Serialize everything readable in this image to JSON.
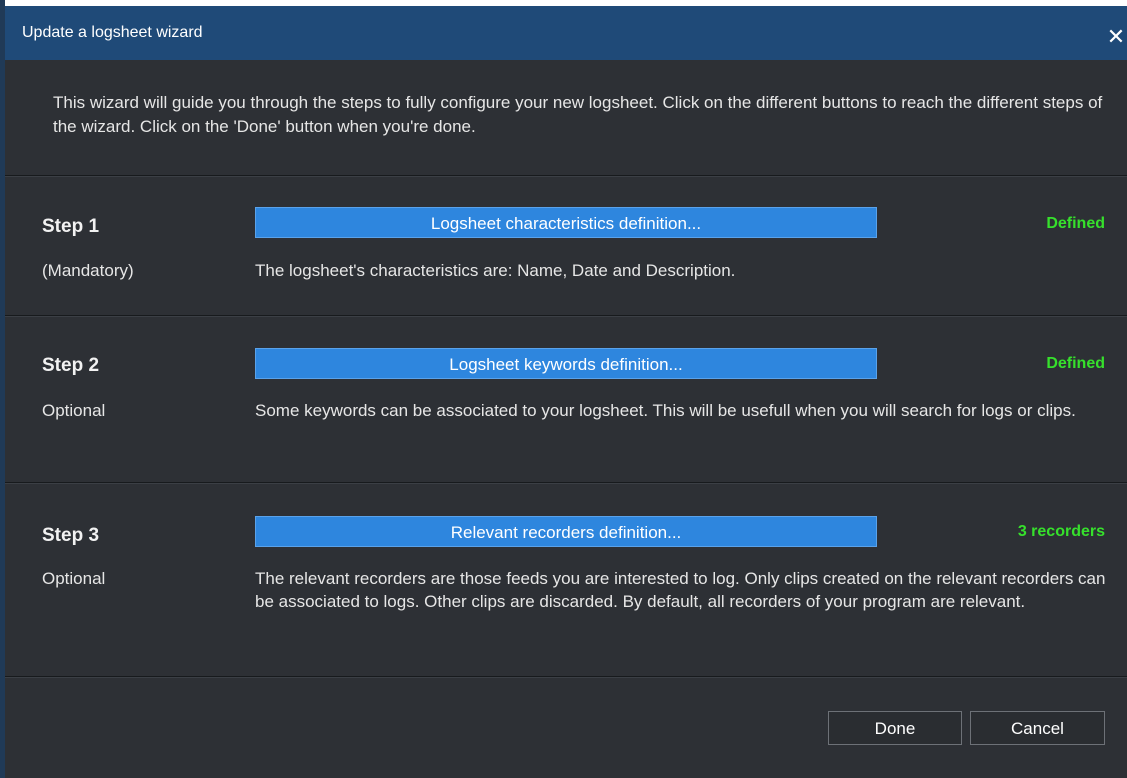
{
  "dialog": {
    "title": "Update a logsheet wizard",
    "close_icon": "✕",
    "intro": "This wizard will guide you through the steps to fully configure your new logsheet. Click on the different buttons to reach the different steps of the wizard. Click on the 'Done' button when you're done."
  },
  "steps": [
    {
      "label": "Step 1",
      "sub": "(Mandatory)",
      "button": "Logsheet characteristics definition...",
      "status": "Defined",
      "description": "The logsheet's characteristics are: Name, Date and Description."
    },
    {
      "label": "Step 2",
      "sub": "Optional",
      "button": "Logsheet keywords definition...",
      "status": "Defined",
      "description": "Some keywords can be associated to your logsheet. This will be usefull when you will search for logs or clips."
    },
    {
      "label": "Step 3",
      "sub": "Optional",
      "button": "Relevant recorders definition...",
      "status": "3 recorders",
      "description": "The relevant recorders are those feeds you are interested to log. Only clips created on the relevant recorders can be associated to logs. Other clips are discarded. By default, all recorders of your program are relevant."
    }
  ],
  "footer": {
    "done_label": "Done",
    "cancel_label": "Cancel"
  },
  "colors": {
    "titlebar": "#1f4a78",
    "background": "#2d3035",
    "step_button": "#2e86de",
    "status_green": "#36e02c"
  }
}
